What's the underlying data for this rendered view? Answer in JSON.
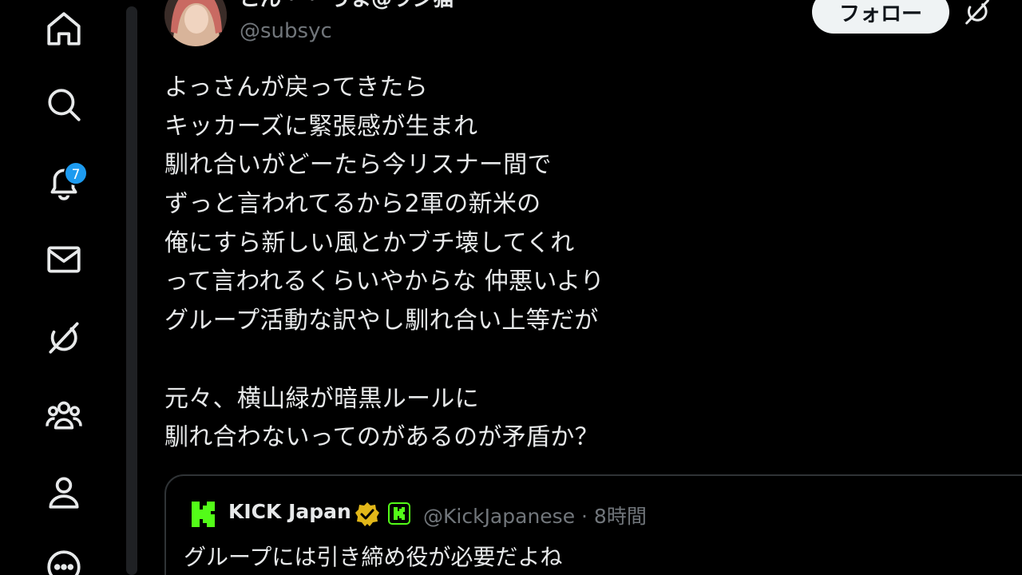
{
  "nav": {
    "items": [
      {
        "icon": "home-icon"
      },
      {
        "icon": "search-icon"
      },
      {
        "icon": "bell-icon",
        "badge": "7"
      },
      {
        "icon": "mail-icon"
      },
      {
        "icon": "grok-icon"
      },
      {
        "icon": "communities-icon"
      },
      {
        "icon": "profile-icon"
      },
      {
        "icon": "more-icon"
      }
    ],
    "notification_badge": "7"
  },
  "post": {
    "display_name": "こん・・ うま@ラジ猫",
    "handle": "@subsyc",
    "follow_label": "フォロー",
    "lines": [
      "よっさんが戻ってきたら",
      "キッカーズに緊張感が生まれ",
      "馴れ合いがどーたら今リスナー間で",
      "ずっと言われてるから2軍の新米の",
      "俺にすら新しい風とかブチ壊してくれ",
      "って言われるくらいやからな 仲悪いより",
      "グループ活動な訳やし馴れ合い上等だが",
      "",
      "元々、横山緑が暗黒ルールに",
      "馴れ合わないってのがあるのが矛盾か？"
    ]
  },
  "quote": {
    "name": "KICK Japan",
    "handle_time": "@KickJapanese · 8時間",
    "text": "グループには引き締め役が必要だよね"
  },
  "colors": {
    "background": "#000000",
    "text": "#e7e9ea",
    "muted": "#71767b",
    "accent": "#1d9bf0",
    "kick_green": "#53fc18",
    "verified_gold": "#e2b719"
  }
}
